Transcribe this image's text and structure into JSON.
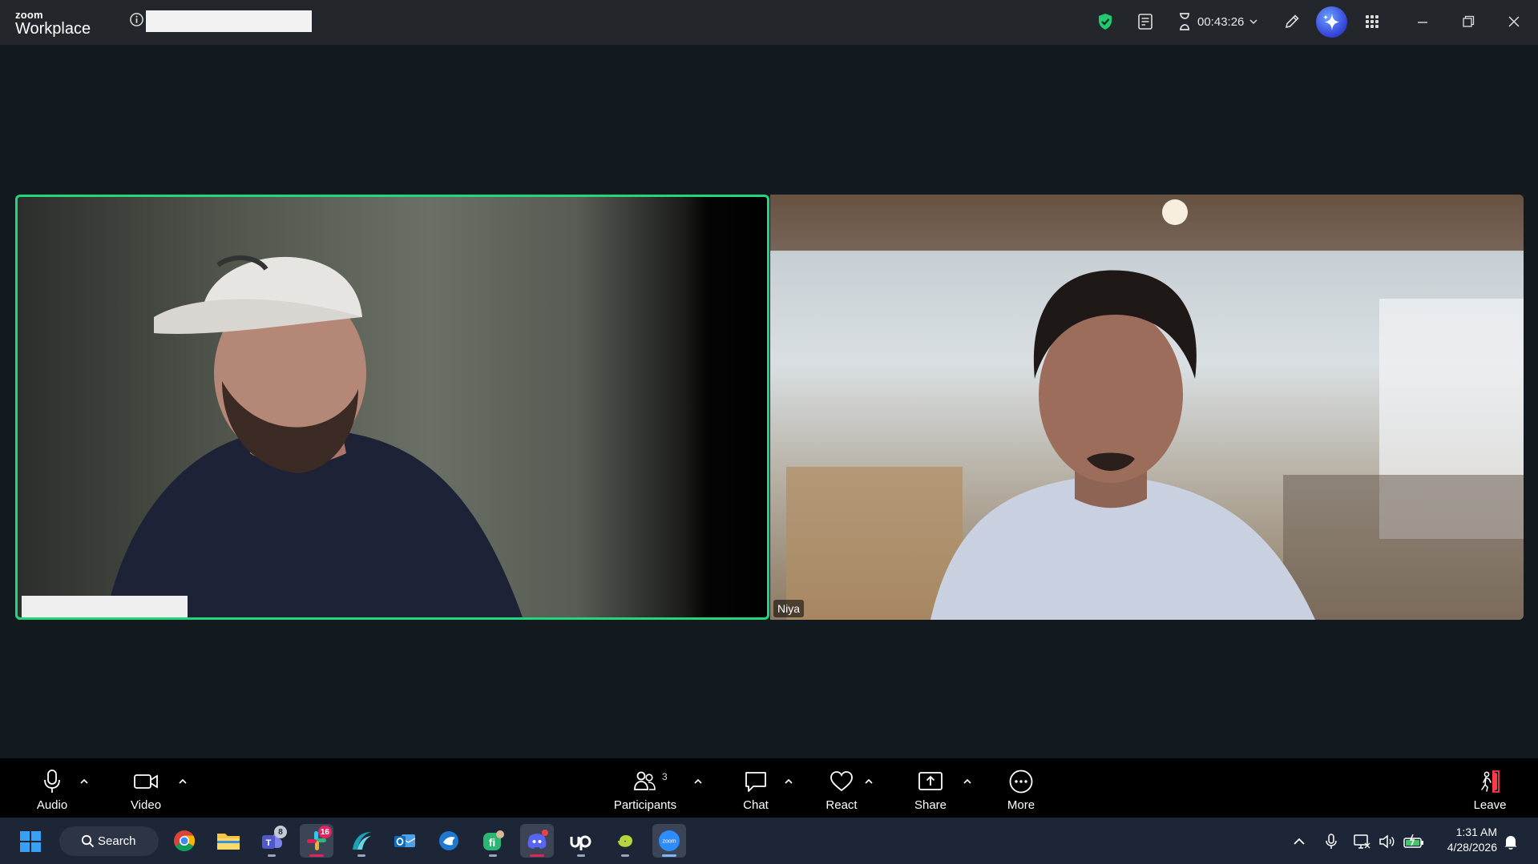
{
  "titlebar": {
    "brand_small": "zoom",
    "brand_big": "Workplace",
    "timer": "00:43:26"
  },
  "video": {
    "right_participant_name": "Niya",
    "active_speaker_color": "#22d77a"
  },
  "toolbar": {
    "audio_label": "Audio",
    "video_label": "Video",
    "participants_label": "Participants",
    "participants_count": "3",
    "chat_label": "Chat",
    "react_label": "React",
    "share_label": "Share",
    "more_label": "More",
    "leave_label": "Leave"
  },
  "taskbar": {
    "search_label": "Search",
    "teams_badge": "8",
    "slack_badge": "16",
    "time": "1:31 AM",
    "date": "4/28/2026"
  },
  "colors": {
    "titlebar_bg": "#23272b",
    "meeting_bg": "#131a1f",
    "toolbar_bg": "#000000",
    "taskbar_bg": "#1c2636",
    "leave_red": "#ff3b4a",
    "shield_green": "#1fcb6e"
  }
}
